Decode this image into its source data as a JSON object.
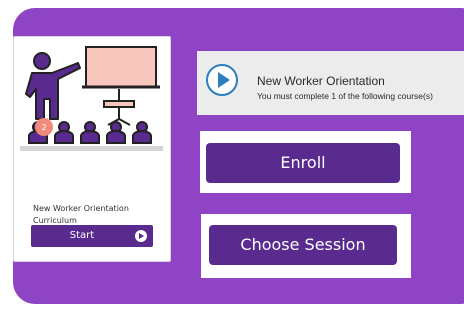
{
  "course_card": {
    "title_line1": "New Worker Orientation",
    "title_line2": "Curriculum",
    "start_label": "Start",
    "badge_number": "2",
    "icon": "classroom-presentation-icon"
  },
  "course_item": {
    "title": "New Worker Orientation",
    "subtitle": "You must complete 1 of the following course(s)",
    "icon": "play-circle-icon"
  },
  "actions": {
    "enroll_label": "Enroll",
    "choose_session_label": "Choose Session"
  },
  "colors": {
    "panel_background": "#8e44c4",
    "button_purple": "#5a2b8e",
    "play_blue": "#2a7fbf",
    "screen_pink": "#f7c6bd",
    "badge_salmon": "#f08a7a"
  }
}
